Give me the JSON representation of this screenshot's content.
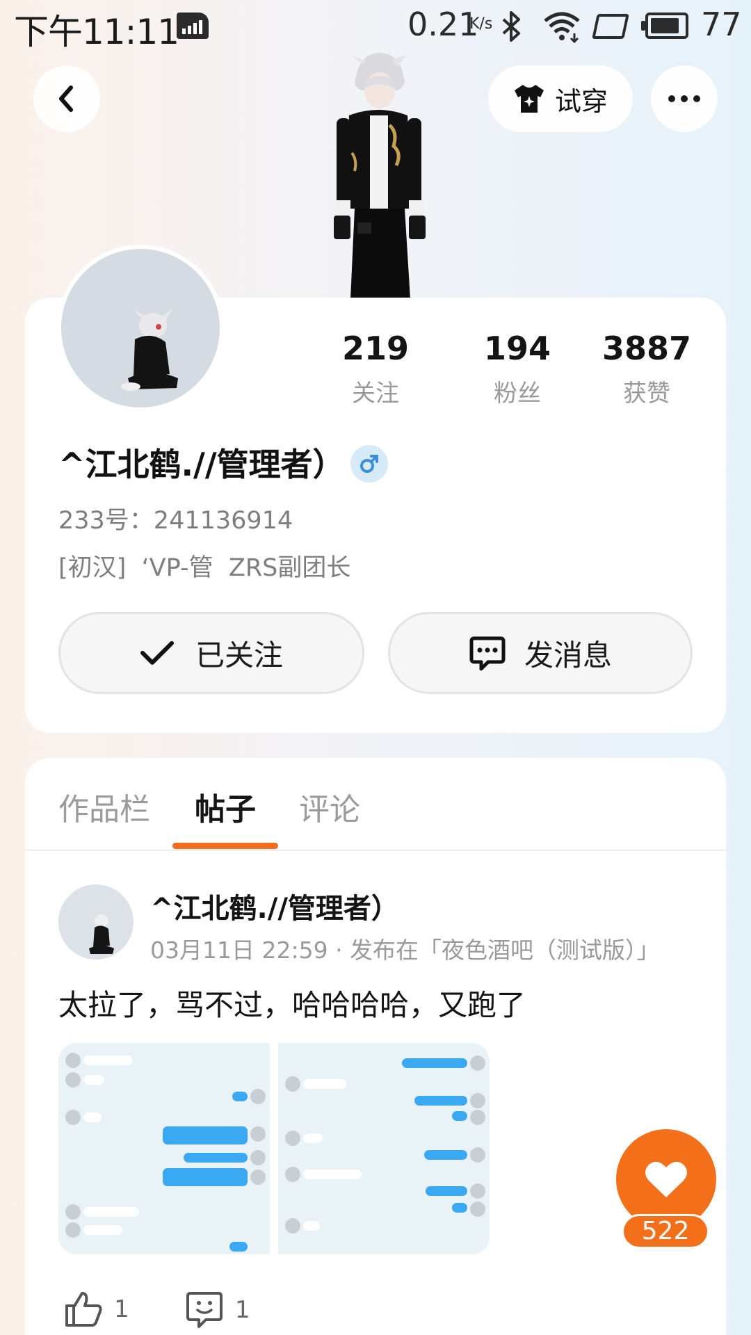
{
  "status_bar": {
    "time": "下午11:11",
    "net_speed": "0.21",
    "net_unit": "K/s",
    "battery": "77",
    "icons": [
      "sim-icon",
      "bluetooth-icon",
      "wifi-icon",
      "sdcard-icon",
      "battery-icon"
    ]
  },
  "nav": {
    "back_icon": "chevron-left-icon",
    "try_on_label": "试穿",
    "try_on_icon": "tshirt-icon",
    "more_icon": "more-horizontal-icon"
  },
  "profile": {
    "username": "^江北鹤.//管理者）",
    "gender_icon": "male-icon",
    "uid": "233号：241136914",
    "bio": "[初汉]  ‘VP-管  ZRS副团长",
    "stats": [
      {
        "value": "219",
        "label": "关注"
      },
      {
        "value": "194",
        "label": "粉丝"
      },
      {
        "value": "3887",
        "label": "获赞"
      }
    ],
    "follow_label": "已关注",
    "message_label": "发消息"
  },
  "tabs": [
    {
      "label": "作品栏",
      "active": false
    },
    {
      "label": "帖子",
      "active": true
    },
    {
      "label": "评论",
      "active": false
    }
  ],
  "post": {
    "author": "^江北鹤.//管理者）",
    "meta": "03月11日 22:59 · 发布在「夜色酒吧（测试版）」",
    "text": "太拉了，骂不过，哈哈哈哈，又跑了",
    "like_count": "1",
    "comment_count": "1",
    "favorite_count": "522"
  },
  "colors": {
    "accent": "#f46f1a",
    "gender_badge": "#d6ebf7",
    "gender_icon": "#3a8fd8"
  }
}
